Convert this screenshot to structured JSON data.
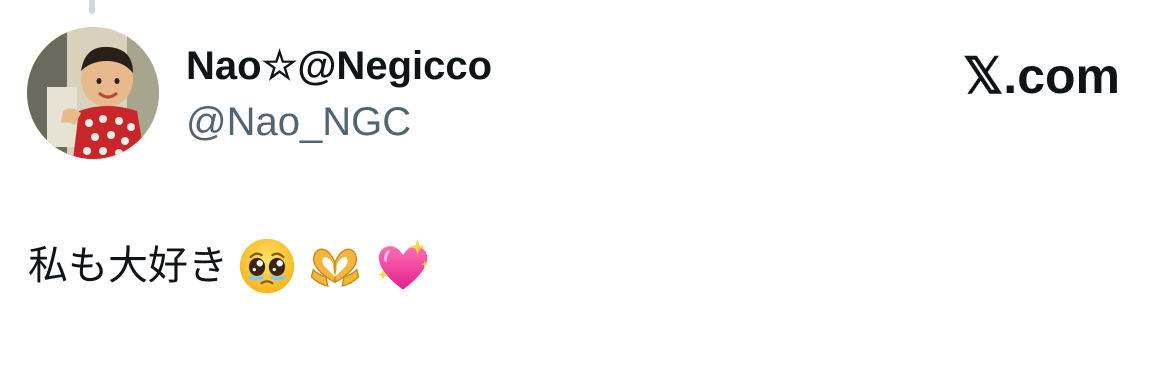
{
  "tweet": {
    "author": {
      "display_name": "Nao☆@Negicco",
      "handle": "@Nao_NGC",
      "avatar": "avatar-photo-child"
    },
    "brand": {
      "label": "𝕏.com",
      "icon": "x-logo"
    },
    "text": "私も大好き",
    "emojis": [
      "pleading-face-icon",
      "heart-hands-icon",
      "sparkling-heart-icon"
    ]
  },
  "colors": {
    "text_primary": "#0f1419",
    "text_secondary": "#536471",
    "thread_line": "#cfd9de"
  }
}
